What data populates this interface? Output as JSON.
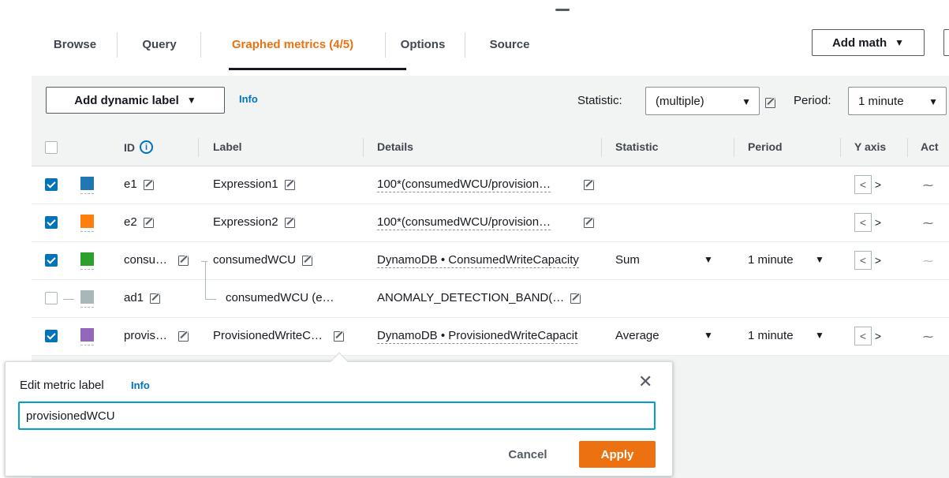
{
  "tabs": [
    {
      "label": "Browse"
    },
    {
      "label": "Query"
    },
    {
      "label": "Graphed metrics (4/5)"
    },
    {
      "label": "Options"
    },
    {
      "label": "Source"
    }
  ],
  "add_math": {
    "label": "Add math",
    "caret": "▼"
  },
  "toolbar": {
    "dynamic_label": "Add dynamic label",
    "caret": "▼",
    "info": "Info",
    "statistic_label": "Statistic:",
    "statistic_value": "(multiple)",
    "period_label": "Period:",
    "period_value": "1 minute"
  },
  "columns": {
    "id": "ID",
    "id_info_glyph": "i",
    "label": "Label",
    "details": "Details",
    "statistic": "Statistic",
    "period": "Period",
    "yaxis": "Y axis",
    "actions": "Act"
  },
  "rows": [
    {
      "checked": true,
      "color": "#1f77b4",
      "id": "e1",
      "label": "Expression1",
      "details": "100*(consumedWCU/provision…",
      "statistic": "",
      "period": ""
    },
    {
      "checked": true,
      "color": "#ff7f0e",
      "id": "e2",
      "label": "Expression2",
      "details": "100*(consumedWCU/provision…",
      "statistic": "",
      "period": ""
    },
    {
      "checked": true,
      "color": "#2ca02c",
      "id": "consu…",
      "label": "consumedWCU",
      "details": "DynamoDB • ConsumedWriteCapacity",
      "statistic": "Sum",
      "period": "1 minute"
    },
    {
      "checked": false,
      "color": "#aab7b8",
      "id": "ad1",
      "label": "consumedWCU (e…",
      "details": "ANOMALY_DETECTION_BAND(…",
      "statistic": "",
      "period": ""
    },
    {
      "checked": true,
      "color": "#9467bd",
      "id": "provis…",
      "label": "ProvisionedWriteC…",
      "details": "DynamoDB • ProvisionedWriteCapacit",
      "statistic": "Average",
      "period": "1 minute"
    }
  ],
  "yaxis_glyphs": {
    "left": "<",
    "right": ">"
  },
  "action_glyph": "⁓",
  "popover": {
    "title": "Edit metric label",
    "info": "Info",
    "input_value": "provisionedWCU",
    "cancel": "Cancel",
    "apply": "Apply",
    "close_glyph": "✕"
  },
  "colors": {
    "accent_orange": "#ec7211",
    "link_blue": "#0073bb",
    "checkbox_blue": "#0073bb",
    "focus_cyan": "#00a1c9"
  }
}
